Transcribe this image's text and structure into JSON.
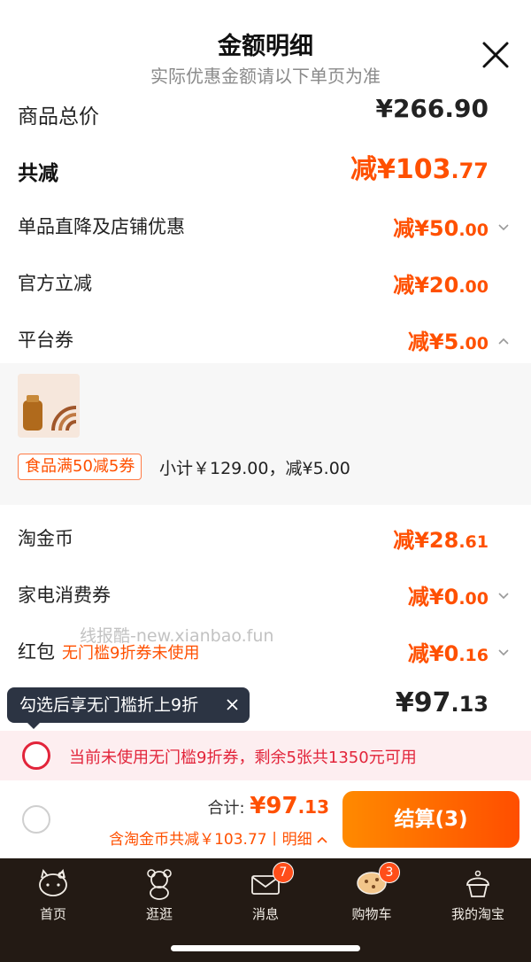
{
  "header": {
    "title": "金额明细",
    "subtitle": "实际优惠金额请以下单页为准"
  },
  "rows": {
    "product_total": {
      "label": "商品总价",
      "amount": "¥266.90"
    },
    "total_discount": {
      "label": "共减",
      "prefix": "减¥",
      "int": "103",
      "dec": ".77"
    },
    "shop_discount": {
      "label": "单品直降及店铺优惠",
      "prefix": "减¥",
      "int": "50",
      "dec": ".00"
    },
    "official": {
      "label": "官方立减",
      "prefix": "减¥",
      "int": "20",
      "dec": ".00"
    },
    "platform_coupon": {
      "label": "平台券",
      "prefix": "减¥",
      "int": "5",
      "dec": ".00"
    },
    "taojinbi": {
      "label": "淘金币",
      "prefix": "减¥",
      "int": "28",
      "dec": ".61"
    },
    "appliance_coupon": {
      "label": "家电消费券",
      "prefix": "减¥",
      "int": "0",
      "dec": ".00"
    },
    "red_packet": {
      "label": "红包",
      "note": "无门槛9折券未使用",
      "prefix": "减¥",
      "int": "0",
      "dec": ".16"
    }
  },
  "coupon_panel": {
    "tag": "食品满50减5券",
    "subtotal": "小计￥129.00，减¥5.00"
  },
  "watermark": "线报酷-new.xianbao.fun",
  "tooltip": {
    "text": "勾选后享无门槛折上9折"
  },
  "final_amount": {
    "prefix": "¥",
    "int": "97",
    "dec": ".13"
  },
  "promo": {
    "text": "当前未使用无门槛9折券，剩余5张共1350元可用"
  },
  "checkout": {
    "total_label": "合计:",
    "price_prefix": "¥",
    "price_int": "97",
    "price_dec": ".13",
    "detail": "含淘金币共减￥103.77丨明细",
    "button": "结算(3)"
  },
  "tabbar": {
    "items": [
      {
        "label": "首页",
        "icon": "hello-kitty-icon"
      },
      {
        "label": "逛逛",
        "icon": "bear-icon"
      },
      {
        "label": "消息",
        "icon": "message-envelope-icon",
        "badge": "7"
      },
      {
        "label": "购物车",
        "icon": "cart-cookie-icon",
        "badge": "3"
      },
      {
        "label": "我的淘宝",
        "icon": "cupcake-icon"
      }
    ]
  },
  "colors": {
    "accent": "#ff5000",
    "promo_red": "#e2243a",
    "tabbar_bg": "#231a14"
  }
}
